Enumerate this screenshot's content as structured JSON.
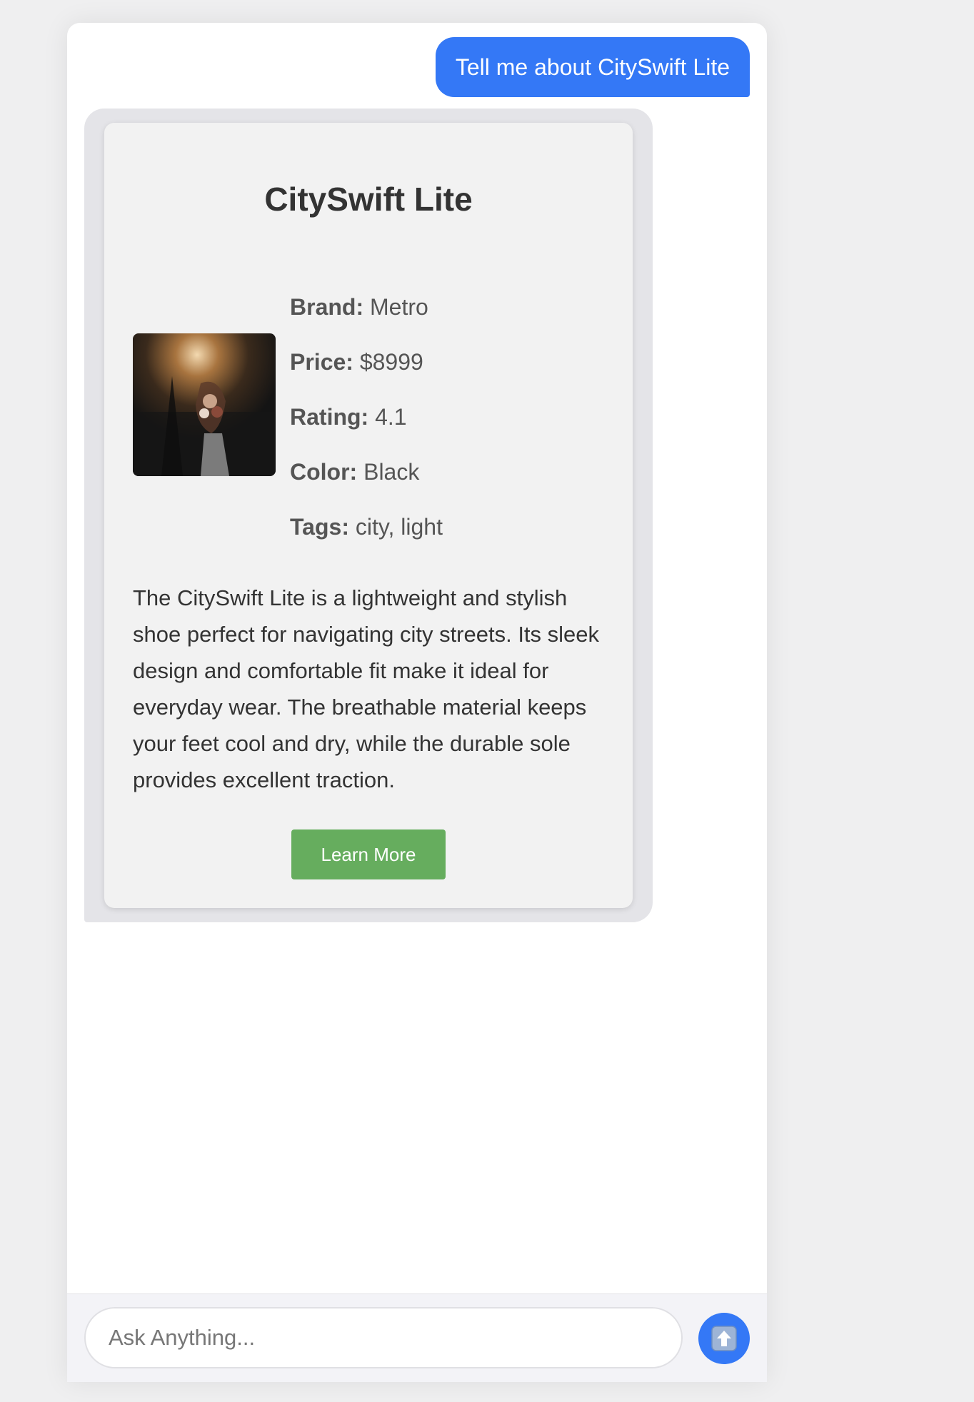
{
  "chat": {
    "user_message": "Tell me about CitySwift Lite",
    "product": {
      "name": "CitySwift Lite",
      "specs": [
        {
          "label": "Brand:",
          "value": "Metro"
        },
        {
          "label": "Price:",
          "value": "$8999"
        },
        {
          "label": "Rating:",
          "value": "4.1"
        },
        {
          "label": "Color:",
          "value": "Black"
        },
        {
          "label": "Tags:",
          "value": "city, light"
        }
      ],
      "description": "The CitySwift Lite is a lightweight and stylish shoe perfect for navigating city streets. Its sleek design and comfortable fit make it ideal for everyday wear. The breathable material keeps your feet cool and dry, while the durable sole provides excellent traction.",
      "button_label": "Learn More"
    }
  },
  "composer": {
    "placeholder": "Ask Anything...",
    "send_icon": "up-arrow-icon"
  },
  "colors": {
    "user_bubble": "#3478f6",
    "learn_more_button": "#66ad5e",
    "send_button": "#3478f6"
  }
}
